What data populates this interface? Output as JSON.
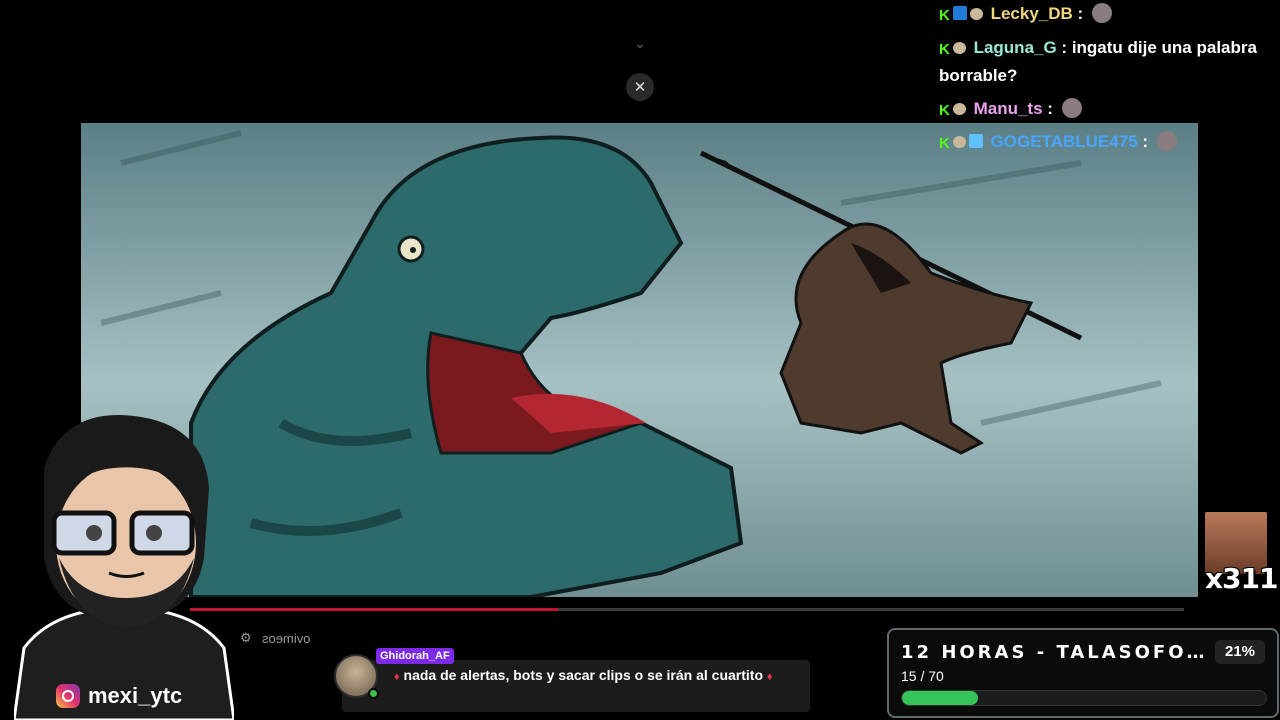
{
  "chat": [
    {
      "user": "Lecky_DB",
      "color": "#f0d67e",
      "badges": [
        "k",
        "blue",
        "mouse"
      ],
      "message": "",
      "emote": true
    },
    {
      "user": "Laguna_G",
      "color": "#9be8d8",
      "badges": [
        "k",
        "mouse"
      ],
      "message": "ingatu dije una palabra borrable?",
      "emote": false
    },
    {
      "user": "Manu_ts",
      "color": "#e9a3ef",
      "badges": [
        "k",
        "mouse"
      ],
      "message": "",
      "emote": true
    },
    {
      "user": "GOGETABLUE475",
      "color": "#4aa5ff",
      "badges": [
        "k",
        "mouse",
        "grid"
      ],
      "message": "",
      "emote": true
    }
  ],
  "video": {
    "progress": 0.37
  },
  "player_controls": {
    "label": "ovimeos"
  },
  "streamer": {
    "handle": "mexi_ytc"
  },
  "highlight": {
    "user": "Ghidorah_AF",
    "message": "nada de alertas, bots y sacar clips o se irán al cuartito"
  },
  "counter": {
    "text": "x311"
  },
  "goal": {
    "title": "12 HORAS - TALASOFO…",
    "percent": "21%",
    "count": "15 / 70",
    "fraction": 0.21
  },
  "colors": {
    "kick_green": "#53fc18",
    "progress_red": "#c4112f",
    "goal_green": "#35c45a",
    "highlight_purple": "#7c2ae8"
  }
}
